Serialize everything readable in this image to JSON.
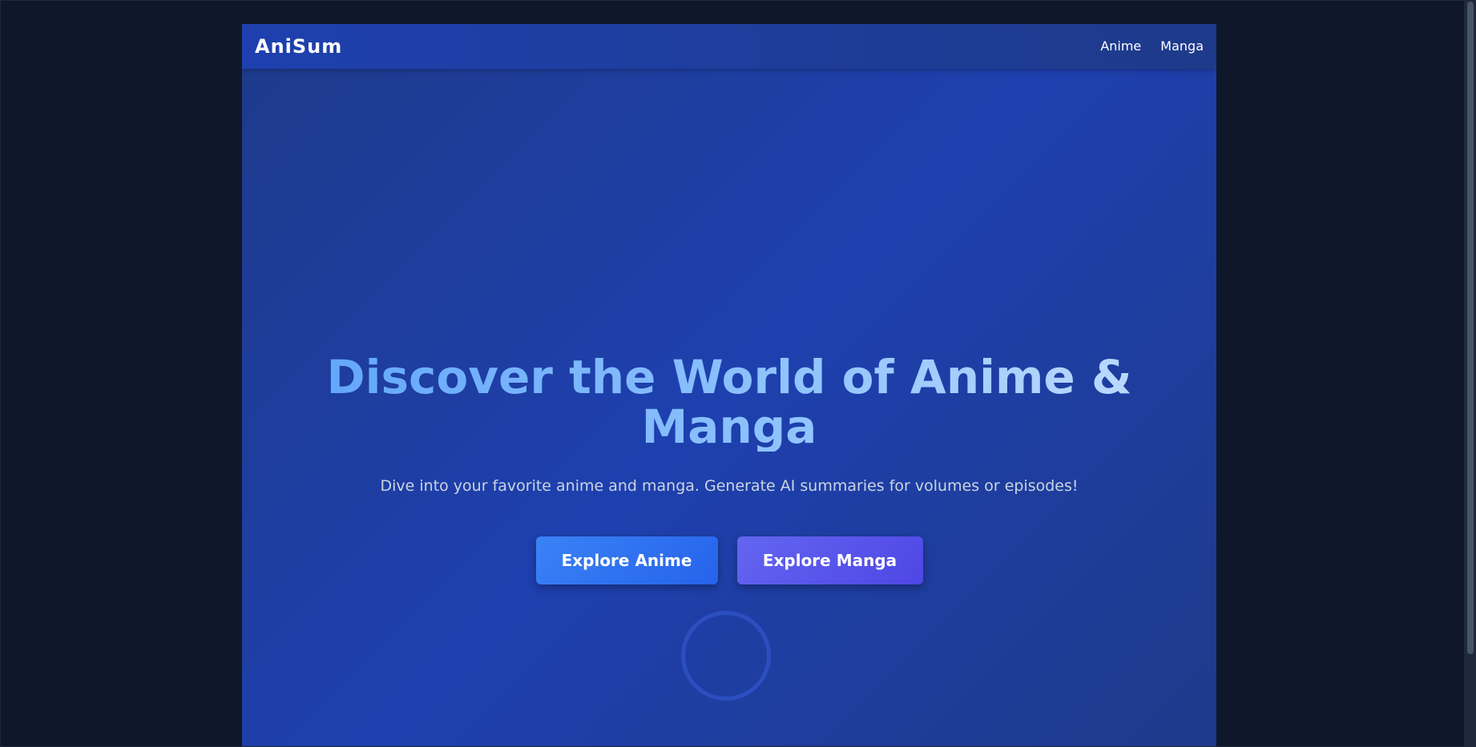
{
  "navbar": {
    "brand": "AniSum",
    "links": [
      {
        "label": "Anime"
      },
      {
        "label": "Manga"
      }
    ]
  },
  "hero": {
    "title": "Discover the World of Anime & Manga",
    "subtitle": "Dive into your favorite anime and manga. Generate AI summaries for volumes or episodes!",
    "buttons": [
      {
        "label": "Explore Anime"
      },
      {
        "label": "Explore Manga"
      }
    ]
  },
  "icons": {
    "loading": "loading-spinner-icon"
  },
  "colors": {
    "background": "#0f172a",
    "page_gradient_start": "#1e3a8a",
    "page_gradient_mid": "#1e40af",
    "title": "#93c5fd",
    "subtitle": "#cbd5e1",
    "anime_button": "#3b82f6",
    "manga_button": "#6366f1"
  }
}
